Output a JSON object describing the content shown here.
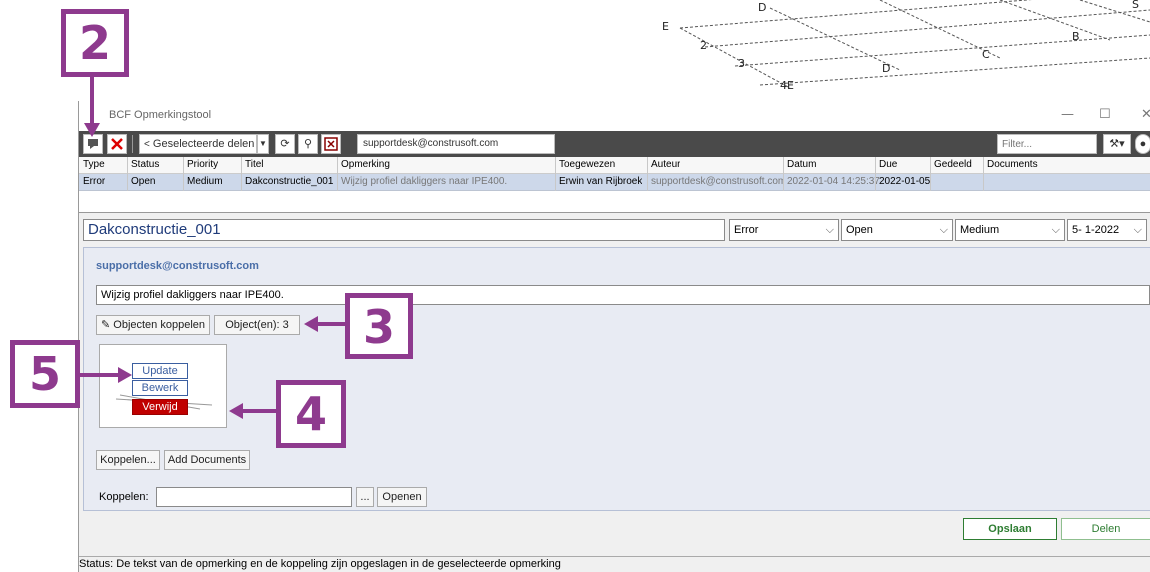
{
  "cad": {
    "labels": [
      "D",
      "E",
      "2",
      "3",
      "4E",
      "D",
      "C",
      "B",
      "S"
    ]
  },
  "window": {
    "title": "BCF Opmerkingstool",
    "minimize": "—",
    "maximize": "☐",
    "close": "✕"
  },
  "toolbar": {
    "selected_parts": "Geselecteerde delen",
    "user": "supportdesk@construsoft.com",
    "filter_placeholder": "Filter..."
  },
  "grid": {
    "headers": [
      "Type",
      "Status",
      "Priority",
      "Titel",
      "Opmerking",
      "Toegewezen",
      "Auteur",
      "Datum",
      "Due",
      "Gedeeld",
      "Documents"
    ],
    "row": [
      "Error",
      "Open",
      "Medium",
      "Dakconstructie_001",
      "Wijzig profiel dakliggers naar IPE400.",
      "Erwin van Rijbroek",
      "supportdesk@construsoft.com",
      "2022-01-04 14:25:37",
      "2022-01-05",
      "",
      ""
    ]
  },
  "detail": {
    "title": "Dakconstructie_001",
    "type": "Error",
    "status": "Open",
    "priority": "Medium",
    "date": "5- 1-2022",
    "author": "supportdesk@construsoft.com",
    "comment": "Wijzig profiel dakliggers naar IPE400.",
    "link_objects": "Objecten koppelen",
    "objects_count": "Object(en): 3",
    "update": "Update",
    "edit": "Bewerk",
    "delete": "Verwijd",
    "link_btn": "Koppelen...",
    "add_documents": "Add Documents",
    "link_label": "Koppelen:",
    "browse": "...",
    "open": "Openen",
    "save": "Opslaan",
    "share": "Delen"
  },
  "status": {
    "text": "Status:  De tekst van de opmerking en de koppeling zijn opgeslagen in de geselecteerde opmerking"
  },
  "callouts": [
    "2",
    "3",
    "4",
    "5"
  ],
  "colors": {
    "accent": "#8e3a8e",
    "delete": "#c00000",
    "save_text": "#2e7d32"
  }
}
